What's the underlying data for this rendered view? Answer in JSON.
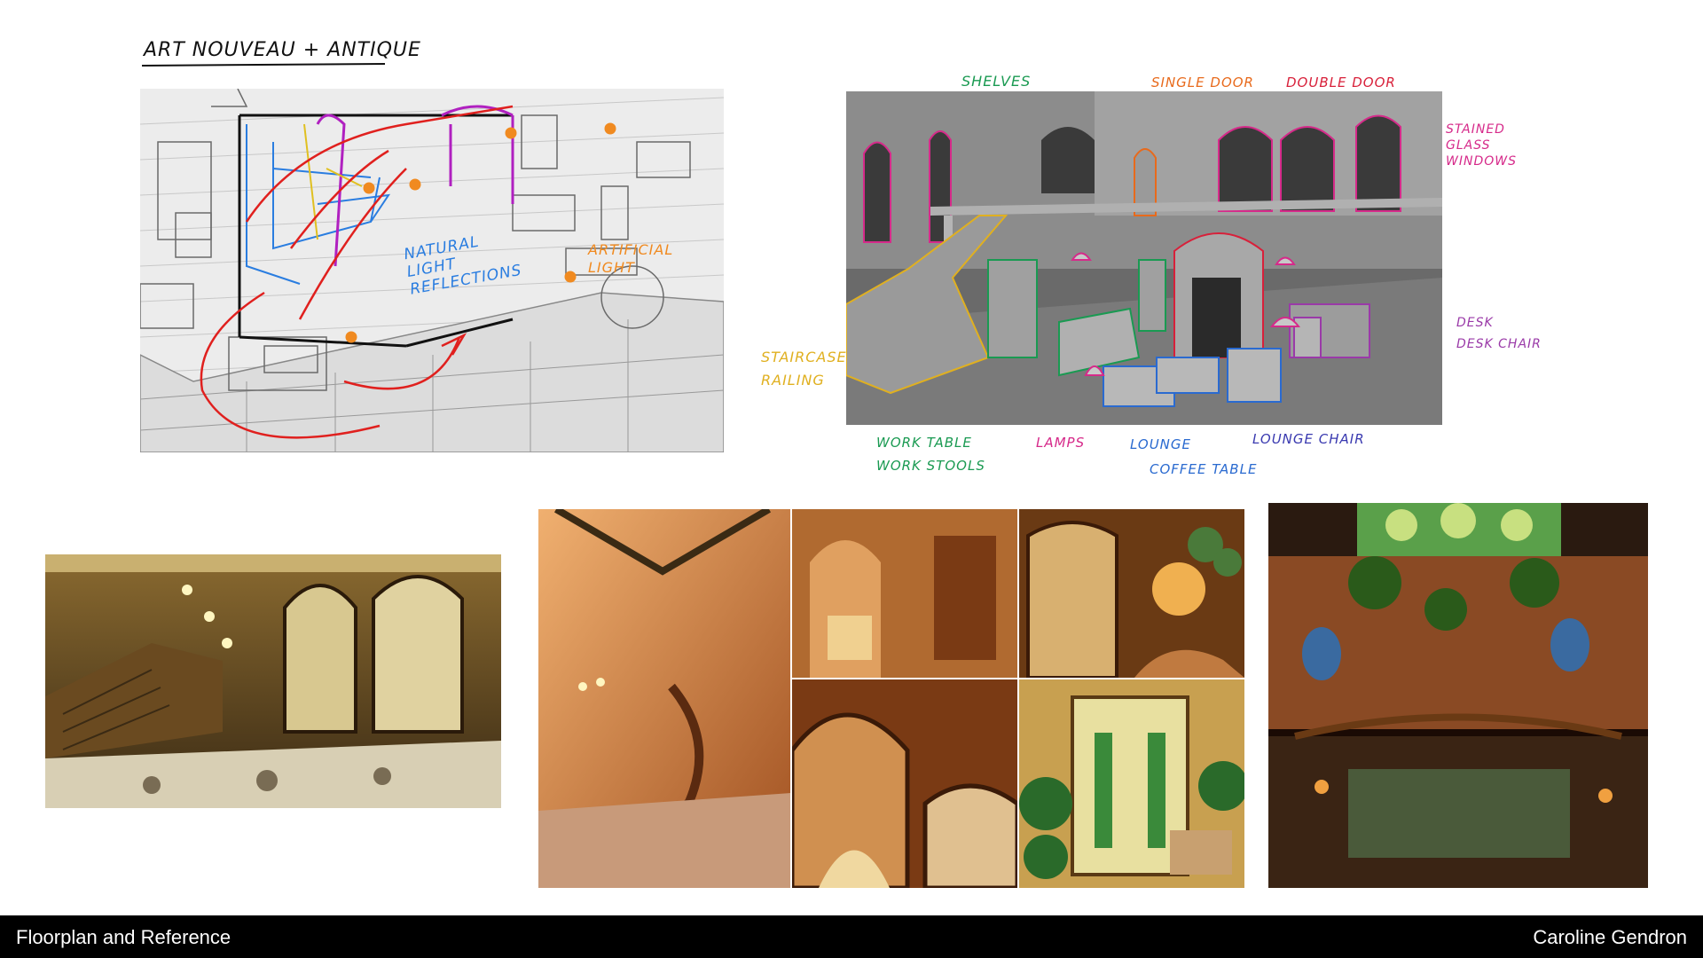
{
  "header": {
    "title": "Art Nouveau + Antique"
  },
  "sketch_panel": {
    "notes": {
      "natural_light": "Natural Light Reflections",
      "artificial_light": "Artificial Light"
    }
  },
  "blockout_panel": {
    "labels": {
      "shelves": "Shelves",
      "single_door": "Single Door",
      "double_door": "Double Door",
      "stained_glass": "Stained Glass Windows",
      "staircase": "Staircase Railing",
      "desk": "Desk",
      "desk_chair": "Desk Chair",
      "work_table": "Work Table",
      "work_stools": "Work Stools",
      "lamps": "Lamps",
      "lounge": "Lounge",
      "coffee_table": "Coffee Table",
      "lounge_chair": "Lounge Chair"
    },
    "colors": {
      "shelves": "#1a9a52",
      "single_door": "#e86a1c",
      "double_door": "#d8203a",
      "stained_glass": "#d62a8a",
      "staircase": "#e0b020",
      "desk": "#9a3aa8",
      "work_table": "#1a9a52",
      "lamps": "#d62a8a",
      "lounge": "#2a6ad0",
      "lounge_chair": "#3a3ab0"
    }
  },
  "footer": {
    "left": "Floorplan and Reference",
    "right": "Caroline Gendron"
  }
}
